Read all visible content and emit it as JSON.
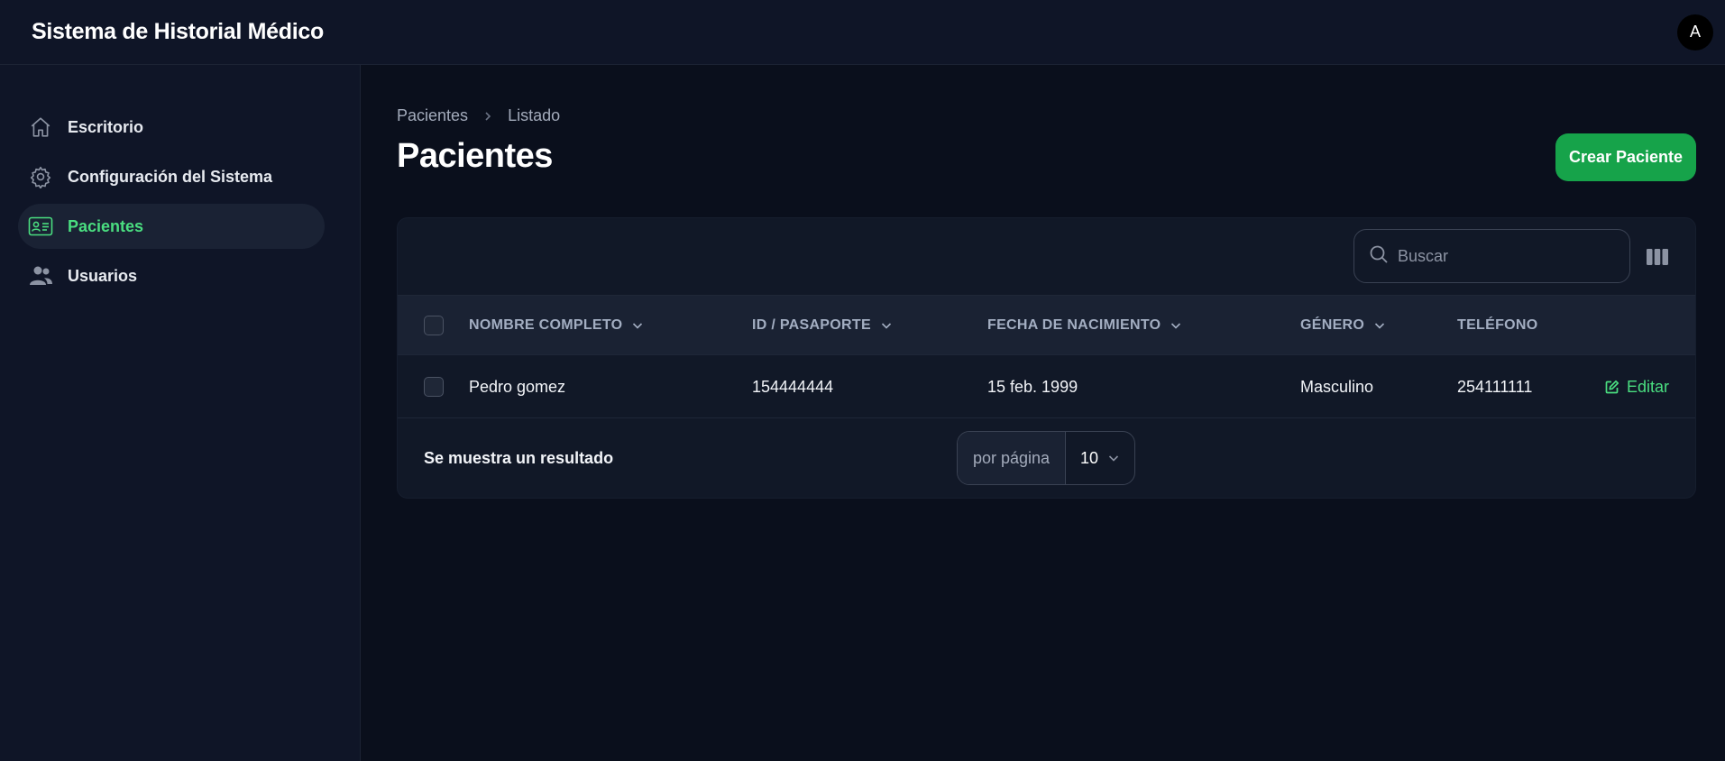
{
  "header": {
    "title": "Sistema de Historial Médico",
    "avatar_letter": "A"
  },
  "sidebar": {
    "items": [
      {
        "label": "Escritorio",
        "icon": "home-icon",
        "active": false
      },
      {
        "label": "Configuración del Sistema",
        "icon": "gear-icon",
        "active": false
      },
      {
        "label": "Pacientes",
        "icon": "id-card-icon",
        "active": true
      },
      {
        "label": "Usuarios",
        "icon": "users-icon",
        "active": false
      }
    ]
  },
  "breadcrumb": {
    "items": [
      "Pacientes",
      "Listado"
    ]
  },
  "page": {
    "title": "Pacientes",
    "create_label": "Crear Paciente"
  },
  "search": {
    "placeholder": "Buscar"
  },
  "table": {
    "columns": [
      "NOMBRE COMPLETO",
      "ID / PASAPORTE",
      "FECHA DE NACIMIENTO",
      "GÉNERO",
      "TELÉFONO"
    ],
    "rows": [
      {
        "name": "Pedro gomez",
        "id": "154444444",
        "dob": "15 feb. 1999",
        "gender": "Masculino",
        "phone": "254111111",
        "action": "Editar"
      }
    ]
  },
  "footer": {
    "result_text": "Se muestra un resultado",
    "per_page_label": "por página",
    "per_page_value": "10"
  },
  "colors": {
    "accent": "#16a34a",
    "accent_text": "#4ade80",
    "background": "#0a0f1c",
    "panel": "#111827"
  }
}
